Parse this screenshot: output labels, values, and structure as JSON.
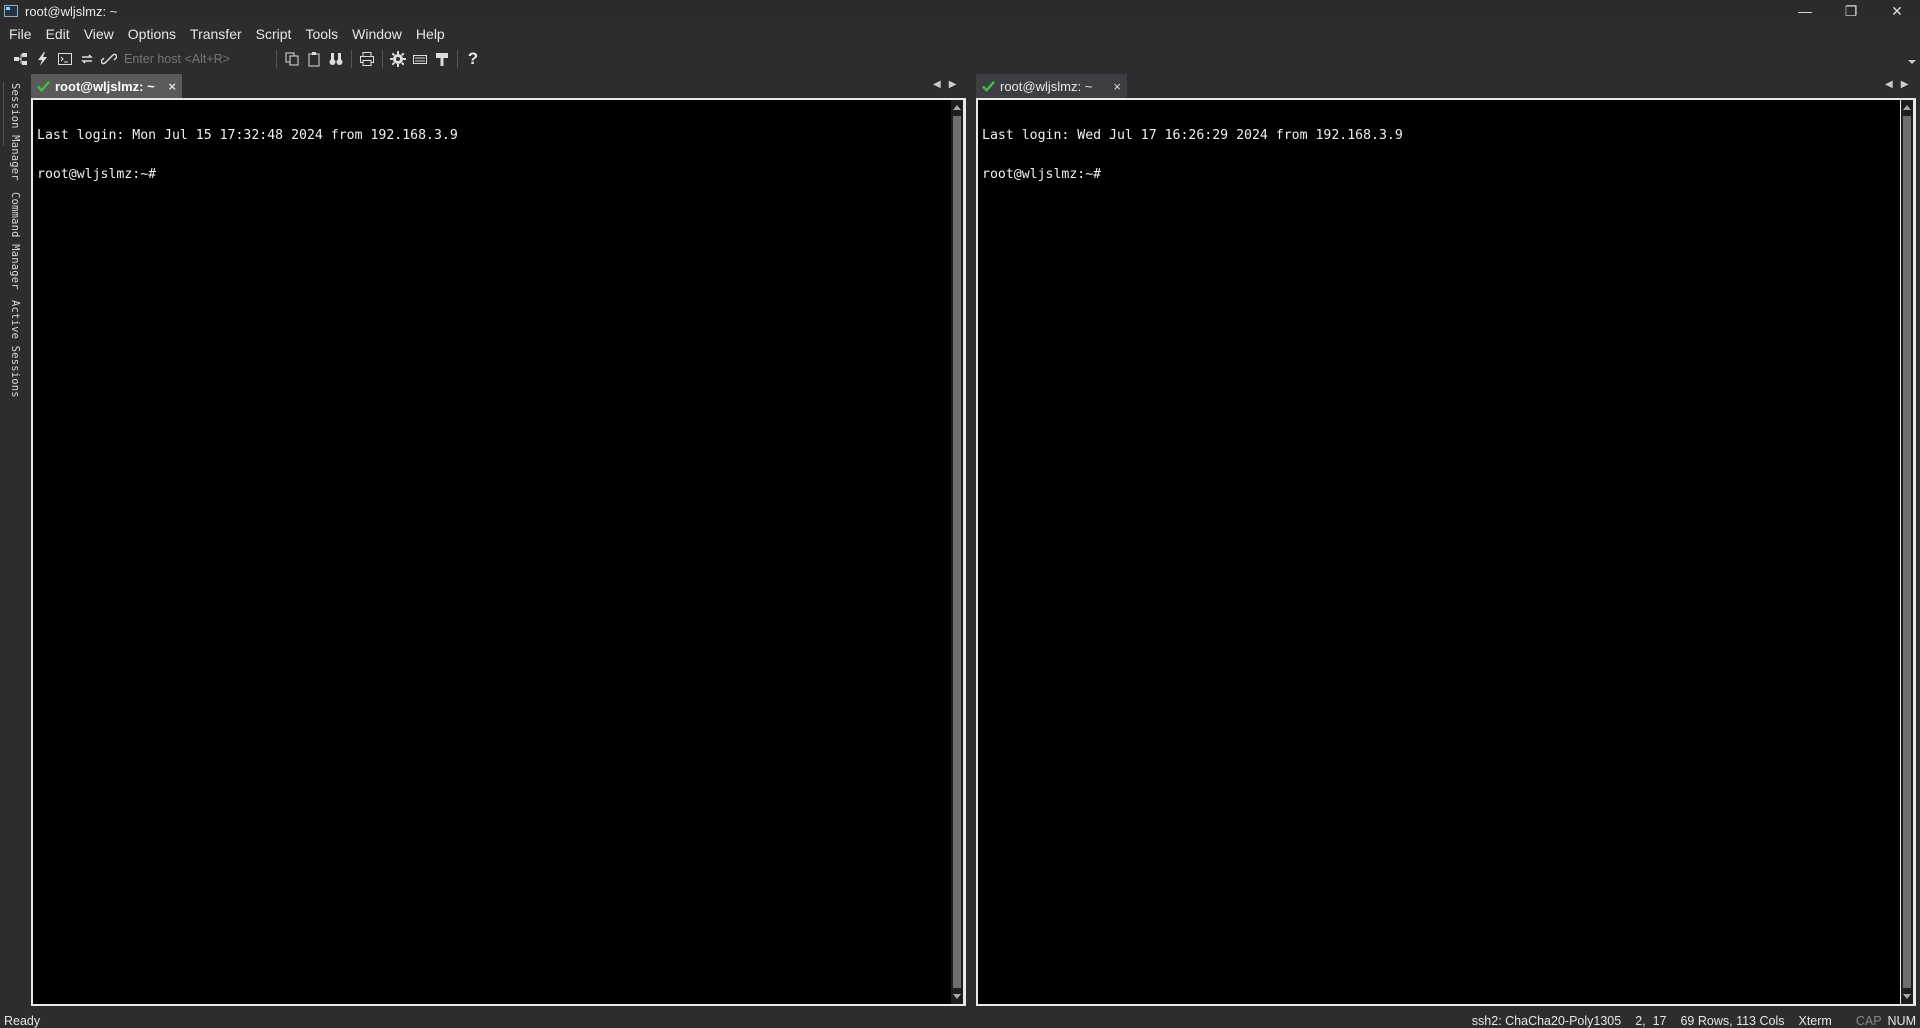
{
  "window": {
    "title": "root@wljslmz: ~",
    "controls": {
      "minimize": "—",
      "restore": "❐",
      "close": "✕"
    }
  },
  "menu": [
    "File",
    "Edit",
    "View",
    "Options",
    "Transfer",
    "Script",
    "Tools",
    "Window",
    "Help"
  ],
  "toolbar": {
    "host_placeholder": "Enter host <Alt+R>",
    "icons": [
      "connect-icon",
      "quick-connect-icon",
      "connect-shell-icon",
      "reconnect-icon",
      "disconnect-icon",
      "copy-icon",
      "paste-icon",
      "find-icon",
      "print-icon",
      "settings-icon",
      "keymap-icon",
      "sftp-icon",
      "help-icon"
    ]
  },
  "side_tabs": [
    "Session Manager",
    "Command Manager",
    "Active Sessions"
  ],
  "panes": [
    {
      "tab_label": "root@wljslmz: ~",
      "close": "×",
      "lines": [
        "Last login: Mon Jul 15 17:32:48 2024 from 192.168.3.9",
        "root@wljslmz:~#"
      ]
    },
    {
      "tab_label": "root@wljslmz: ~",
      "close": "×",
      "lines": [
        "Last login: Wed Jul 17 16:26:29 2024 from 192.168.3.9",
        "root@wljslmz:~#"
      ]
    }
  ],
  "status": {
    "ready": "Ready",
    "cipher": "ssh2: ChaCha20-Poly1305",
    "cursor": "2,  17",
    "size": "69 Rows, 113 Cols",
    "term": "Xterm",
    "cap": "CAP",
    "num": "NUM"
  },
  "colors": {
    "accent_check": "#3fbf3f",
    "background": "#2d2d30",
    "terminal_bg": "#000000"
  }
}
